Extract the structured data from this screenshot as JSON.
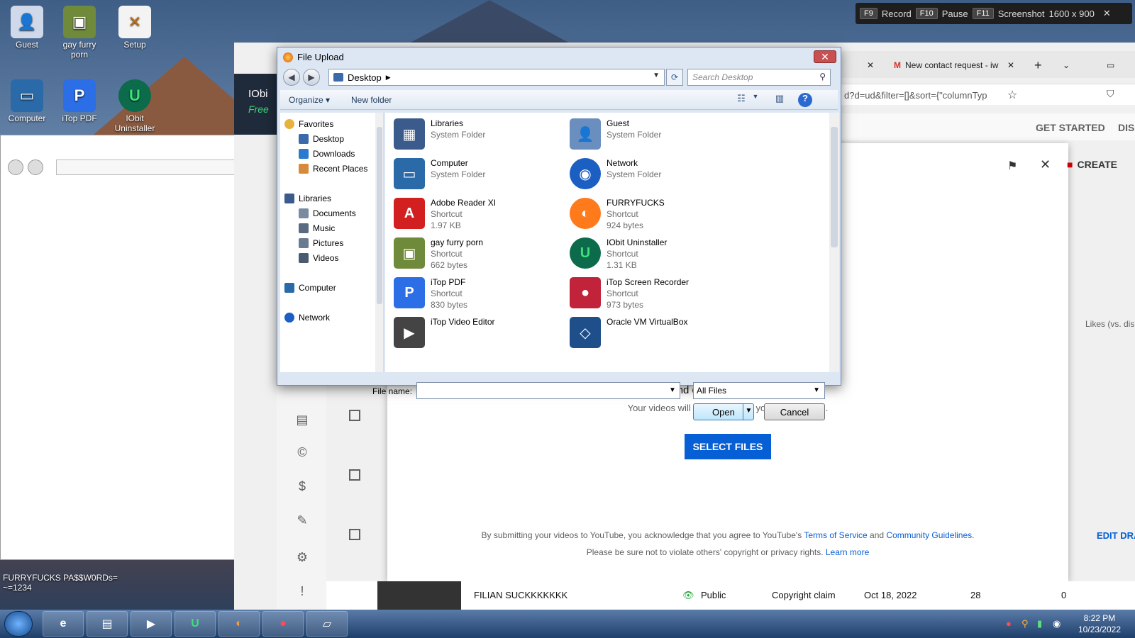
{
  "desktop": {
    "icons": [
      {
        "label": "Guest",
        "icon": "user-icon"
      },
      {
        "label": "gay furry porn",
        "icon": "game-box-icon"
      },
      {
        "label": "Setup",
        "icon": "hxd-icon"
      },
      {
        "label": "Computer",
        "icon": "computer-icon"
      },
      {
        "label": "iTop PDF",
        "icon": "pdf-icon"
      },
      {
        "label": "IObit Uninstaller",
        "icon": "uninstaller-icon"
      }
    ],
    "overlay_text": "FURRYFUCKS PA$$W0RDs=\n~=1234"
  },
  "recorder_bar": {
    "record_key": "F9",
    "record_label": "Record",
    "pause_key": "F10",
    "pause_label": "Pause",
    "screenshot_key": "F11",
    "screenshot_label": "Screenshot",
    "resolution": "1600 x 900"
  },
  "browser": {
    "tab_label": "New contact request - iw",
    "url_fragment": "d?d=ud&filter=[]&sort={\"columnTyp",
    "behind_panel": {
      "title": "IObi",
      "subtitle": "Free"
    },
    "header_links": {
      "get_started": "GET STARTED",
      "dis": "DIS"
    },
    "create_label": "CREATE",
    "likes_label": "Likes (vs. dis",
    "edit_draft": "EDIT DRA"
  },
  "upload_modal": {
    "title": "Drag and drop video files to upload",
    "subtitle": "Your videos will be private until you publish them.",
    "select_button": "SELECT FILES",
    "terms_prefix": "By submitting your videos to YouTube, you acknowledge that you agree to YouTube's",
    "terms_link": "Terms of Service",
    "terms_and": "and",
    "guidelines_link": "Community Guidelines.",
    "rights_text": "Please be sure not to violate others' copyright or privacy rights.",
    "learn_more": "Learn more"
  },
  "content_row": {
    "title": "FILIAN SUCKKKKKKK",
    "visibility": "Public",
    "restriction": "Copyright claim",
    "date": "Oct 18, 2022",
    "views": "28",
    "comments": "0"
  },
  "file_dialog": {
    "title": "File Upload",
    "close": "✕",
    "path": "Desktop",
    "search_placeholder": "Search Desktop",
    "organize": "Organize ▾",
    "new_folder": "New folder",
    "nav": [
      {
        "label": "Favorites",
        "level": 0
      },
      {
        "label": "Desktop",
        "level": 1
      },
      {
        "label": "Downloads",
        "level": 1
      },
      {
        "label": "Recent Places",
        "level": 1
      },
      {
        "label": "Libraries",
        "level": 0
      },
      {
        "label": "Documents",
        "level": 1
      },
      {
        "label": "Music",
        "level": 1
      },
      {
        "label": "Pictures",
        "level": 1
      },
      {
        "label": "Videos",
        "level": 1
      },
      {
        "label": "Computer",
        "level": 0
      },
      {
        "label": "Network",
        "level": 0
      }
    ],
    "files": [
      {
        "name": "Libraries",
        "type": "System Folder",
        "size": "",
        "color": "#3b5b8c"
      },
      {
        "name": "Guest",
        "type": "System Folder",
        "size": "",
        "color": "#6a8fbf"
      },
      {
        "name": "Computer",
        "type": "System Folder",
        "size": "",
        "color": "#2a6aa8"
      },
      {
        "name": "Network",
        "type": "System Folder",
        "size": "",
        "color": "#1b5fc2"
      },
      {
        "name": "Adobe Reader XI",
        "type": "Shortcut",
        "size": "1.97 KB",
        "color": "#d21f1f"
      },
      {
        "name": "FURRYFUCKS",
        "type": "Shortcut",
        "size": "924 bytes",
        "color": "#ff7a1a"
      },
      {
        "name": "gay furry porn",
        "type": "Shortcut",
        "size": "662 bytes",
        "color": "#6f8a3a"
      },
      {
        "name": "IObit Uninstaller",
        "type": "Shortcut",
        "size": "1.31 KB",
        "color": "#0b6b4a"
      },
      {
        "name": "iTop PDF",
        "type": "Shortcut",
        "size": "830 bytes",
        "color": "#2b6ee6"
      },
      {
        "name": "iTop Screen Recorder",
        "type": "Shortcut",
        "size": "973 bytes",
        "color": "#c0233a"
      },
      {
        "name": "iTop Video Editor",
        "type": "",
        "size": "",
        "color": "#444444"
      },
      {
        "name": "Oracle VM VirtualBox",
        "type": "",
        "size": "",
        "color": "#1e4f8a"
      }
    ],
    "file_name_label": "File name:",
    "file_name_value": "",
    "file_type": "All Files",
    "open_button": "Open",
    "cancel_button": "Cancel"
  },
  "taskbar": {
    "time": "8:22 PM",
    "date": "10/23/2022"
  }
}
